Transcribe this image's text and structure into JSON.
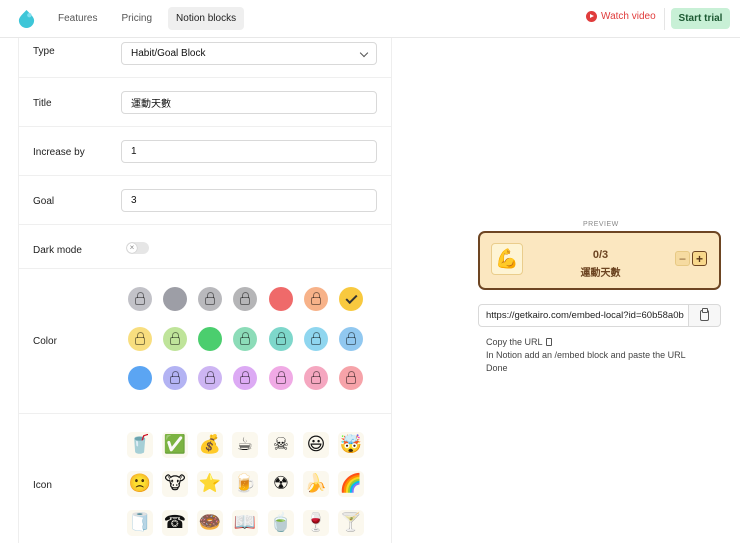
{
  "header": {
    "nav": [
      "Features",
      "Pricing",
      "Notion blocks"
    ],
    "active_nav": "Notion blocks",
    "watch_video": "Watch video",
    "start_trial": "Start trial"
  },
  "form": {
    "type": {
      "label": "Type",
      "value": "Habit/Goal Block"
    },
    "title": {
      "label": "Title",
      "value": "運動天數"
    },
    "increase_by": {
      "label": "Increase by",
      "value": "1"
    },
    "goal": {
      "label": "Goal",
      "value": "3"
    },
    "dark_mode": {
      "label": "Dark mode",
      "enabled": false
    },
    "color": {
      "label": "Color",
      "swatches": [
        [
          "#c2c2c8",
          "#9d9ea6",
          "#b9b9bd",
          "#b5b5b7",
          "#ef6a6a",
          "#f7b289",
          "#f8c93f"
        ],
        [
          "#f8de7f",
          "#bfe49a",
          "#4bce6e",
          "#8cdcb8",
          "#7ed7cb",
          "#8fd6ef",
          "#91c8f0"
        ],
        [
          "#5ba5f3",
          "#b3b3f3",
          "#cdb5f3",
          "#dcaaf4",
          "#f0aae5",
          "#f5a7c0",
          "#f6a3a9"
        ]
      ],
      "selected": "#f8c93f"
    },
    "icon": {
      "label": "Icon",
      "glyphs": [
        [
          "🥤",
          "✅",
          "💰",
          "☕",
          "☠",
          "😃",
          "🤯"
        ],
        [
          "🙁",
          "🐮",
          "⭐",
          "🍺",
          "☢",
          "🍌",
          "🌈"
        ],
        [
          "🧻",
          "☎",
          "🍩",
          "📖",
          "🍵",
          "🍷",
          "🍸"
        ]
      ]
    }
  },
  "preview": {
    "label": "PREVIEW",
    "icon": "💪",
    "count": "0/3",
    "title": "運動天數",
    "minus": "−",
    "plus": "+"
  },
  "embed": {
    "url": "https://getkairo.com/embed-local?id=60b58a0b",
    "steps": [
      "Copy the URL",
      "In Notion add an /embed block and paste the URL",
      "Done"
    ]
  }
}
